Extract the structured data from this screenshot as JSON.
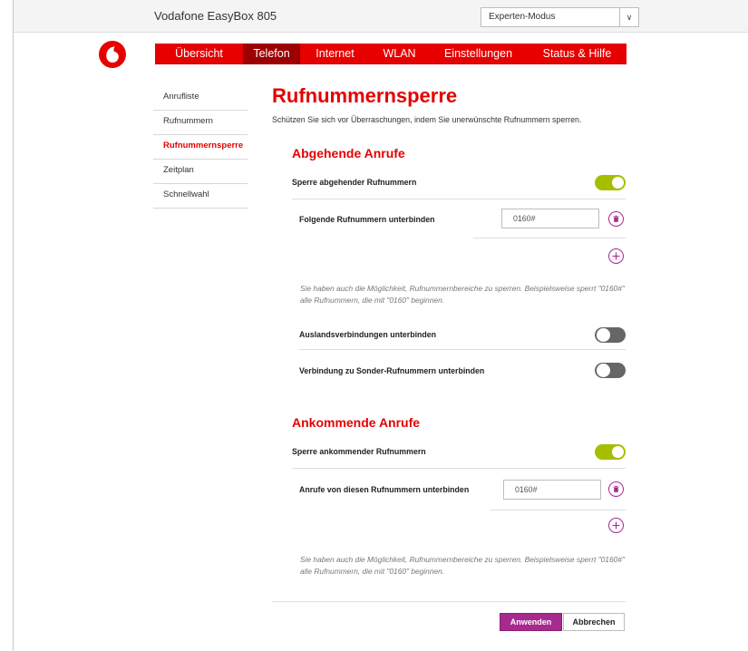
{
  "header": {
    "brand": "Vodafone EasyBox 805",
    "mode_select": {
      "value": "Experten-Modus"
    }
  },
  "nav": {
    "tabs": [
      {
        "label": "Übersicht",
        "active": false
      },
      {
        "label": "Telefon",
        "active": true
      },
      {
        "label": "Internet",
        "active": false
      },
      {
        "label": "WLAN",
        "active": false
      },
      {
        "label": "Einstellungen",
        "active": false
      },
      {
        "label": "Status & Hilfe",
        "active": false
      }
    ]
  },
  "sidebar": {
    "items": [
      {
        "label": "Anrufliste",
        "active": false
      },
      {
        "label": "Rufnummern",
        "active": false
      },
      {
        "label": "Rufnummernsperre",
        "active": true
      },
      {
        "label": "Zeitplan",
        "active": false
      },
      {
        "label": "Schnellwahl",
        "active": false
      }
    ]
  },
  "page": {
    "title": "Rufnummernsperre",
    "intro": "Schützen Sie sich vor Überraschungen, indem Sie unerwünschte Rufnummern sperren."
  },
  "outgoing": {
    "title": "Abgehende Anrufe",
    "block_label": "Sperre abgehender Rufnummern",
    "block_on": true,
    "numbers_label": "Folgende Rufnummern unterbinden",
    "number_value": "0160#",
    "hint": "Sie haben auch die Möglichkeit, Rufnummernbereiche zu sperren. Beispielsweise sperrt \"0160#\" alle Rufnummern, die mit \"0160\" beginnen.",
    "international_label": "Auslandsverbindungen unterbinden",
    "international_on": false,
    "special_label": "Verbindung zu Sonder-Rufnummern unterbinden",
    "special_on": false
  },
  "incoming": {
    "title": "Ankommende Anrufe",
    "block_label": "Sperre ankommender Rufnummern",
    "block_on": true,
    "numbers_label": "Anrufe von diesen Rufnummern unterbinden",
    "number_value": "0160#",
    "hint": "Sie haben auch die Möglichkeit, Rufnummernbereiche zu sperren. Beispielsweise sperrt \"0160#\" alle Rufnummern, die mit \"0160\" beginnen."
  },
  "actions": {
    "apply_label": "Anwenden",
    "cancel_label": "Abbrechen"
  },
  "colors": {
    "brand_red": "#e60000",
    "active_tab": "#9c0000",
    "accent_purple": "#a72a8e",
    "toggle_on": "#a6be00",
    "toggle_off": "#666666"
  }
}
